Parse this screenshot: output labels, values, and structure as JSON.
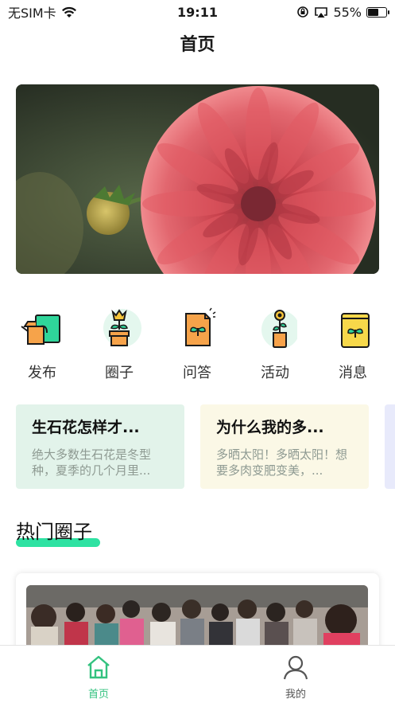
{
  "status_bar": {
    "carrier": "无SIM卡",
    "time": "19:11",
    "battery_percent": "55%",
    "battery_level": 0.55,
    "icons": [
      "wifi-icon",
      "orientation-lock-icon",
      "airplay-icon",
      "battery-icon"
    ]
  },
  "nav": {
    "title": "首页"
  },
  "banner": {
    "image": "red-dahlia-flower-photo"
  },
  "quick_entries": [
    {
      "label": "发布",
      "icon": "watering-can-icon"
    },
    {
      "label": "圈子",
      "icon": "potted-flower-icon"
    },
    {
      "label": "问答",
      "icon": "seed-packet-icon"
    },
    {
      "label": "活动",
      "icon": "flower-vase-icon"
    },
    {
      "label": "消息",
      "icon": "seed-bag-icon"
    }
  ],
  "question_cards": [
    {
      "title": "生石花怎样才...",
      "desc": "绝大多数生石花是冬型种，夏季的几个月里...",
      "bg": "#e2f3ea"
    },
    {
      "title": "为什么我的多...",
      "desc": "多晒太阳！多晒太阳！想要多肉变肥变美，...",
      "bg": "#fbf8e6"
    }
  ],
  "section": {
    "title": "热门圈子"
  },
  "hot_circle": {
    "image": "crowd-photo"
  },
  "tab_bar": {
    "items": [
      {
        "label": "首页",
        "icon": "home-icon",
        "active": true
      },
      {
        "label": "我的",
        "icon": "user-icon",
        "active": false
      }
    ]
  },
  "colors": {
    "accent": "#2ee2a2",
    "tab_active": "#33c27f",
    "tab_inactive": "#555555"
  }
}
